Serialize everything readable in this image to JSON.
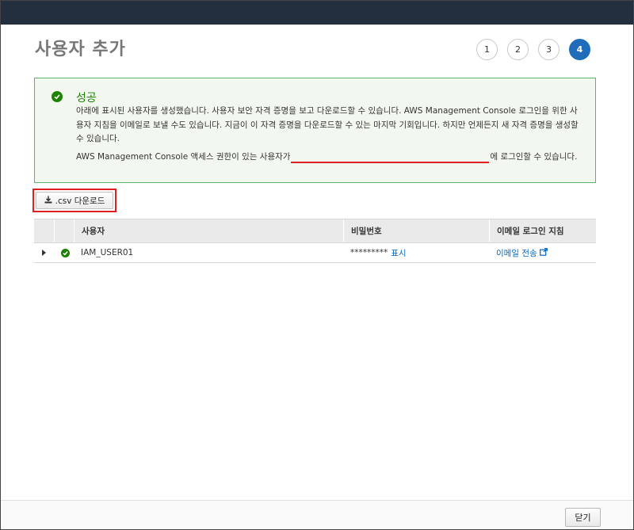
{
  "page": {
    "title": "사용자 추가"
  },
  "steps": [
    "1",
    "2",
    "3",
    "4"
  ],
  "active_step": "4",
  "alert": {
    "title": "성공",
    "body": "아래에 표시된 사용자를 생성했습니다. 사용자 보안 자격 증명을 보고 다운로드할 수 있습니다. AWS Management Console 로그인을 위한 사용자 지침을 이메일로 보낼 수도 있습니다. 지금이 이 자격 증명을 다운로드할 수 있는 마지막 기회입니다. 하지만 언제든지 새 자격 증명을 생성할 수 있습니다.",
    "login_prefix": "AWS Management Console 액세스 권한이 있는 사용자가",
    "login_suffix": "에 로그인할 수 있습니다."
  },
  "csv_button": {
    "label": ".csv 다운로드"
  },
  "table": {
    "headers": {
      "user": "사용자",
      "password": "비밀번호",
      "email": "이메일 로그인 지침"
    },
    "rows": [
      {
        "user": "IAM_USER01",
        "password": "*********",
        "password_link": "표시",
        "email_link": "이메일 전송"
      }
    ]
  },
  "footer": {
    "close_label": "닫기"
  },
  "colors": {
    "topbar": "#232f3e",
    "success": "#1d8102",
    "link": "#0066c0",
    "active_step": "#1f6dba",
    "highlight": "#e02020"
  }
}
